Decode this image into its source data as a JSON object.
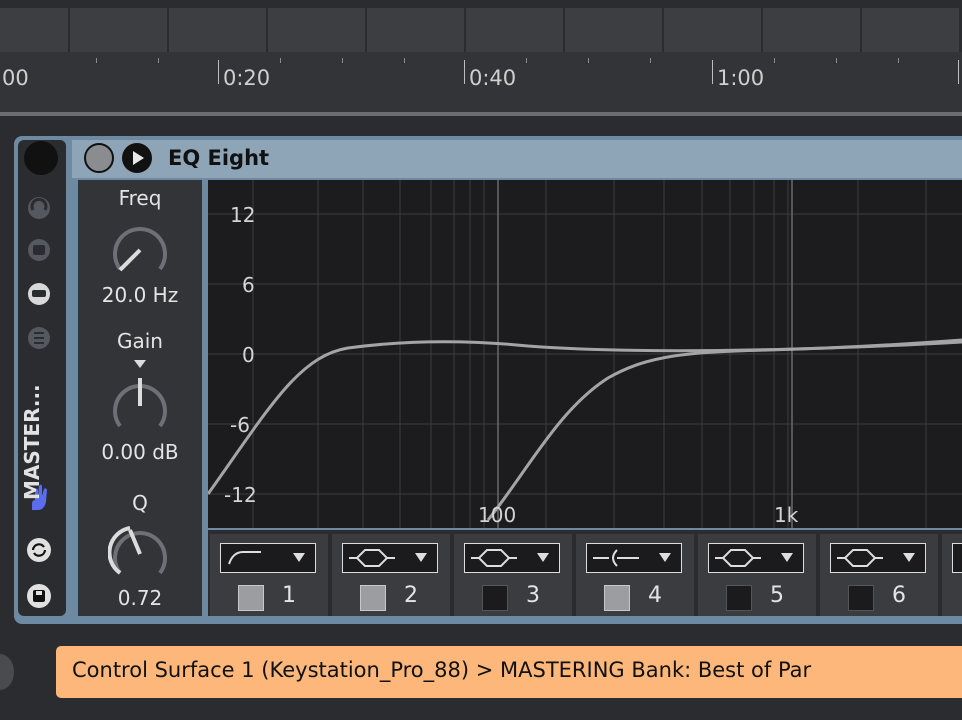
{
  "timeline": {
    "labels": [
      "00",
      "0:20",
      "0:40",
      "1:00"
    ]
  },
  "device": {
    "title": "EQ Eight",
    "sidebar_label": "MASTER...",
    "params": {
      "freq_label": "Freq",
      "freq_value": "20.0 Hz",
      "gain_label": "Gain",
      "gain_value": "0.00 dB",
      "q_label": "Q",
      "q_value": "0.72"
    },
    "graph": {
      "y_labels": [
        "12",
        "6",
        "0",
        "-6",
        "-12"
      ],
      "x_labels": [
        "100",
        "1k"
      ]
    },
    "bands": [
      {
        "number": "1",
        "filter": "high-pass",
        "active": true
      },
      {
        "number": "2",
        "filter": "bell",
        "active": true
      },
      {
        "number": "3",
        "filter": "bell",
        "active": false
      },
      {
        "number": "4",
        "filter": "notch",
        "active": true
      },
      {
        "number": "5",
        "filter": "bell",
        "active": false
      },
      {
        "number": "6",
        "filter": "bell",
        "active": false
      }
    ]
  },
  "status_bar": {
    "text": "Control Surface 1 (Keystation_Pro_88) > MASTERING Bank: Best of Par"
  },
  "colors": {
    "device_frame": "#6d8aa2",
    "title_bar": "#8ea5b7",
    "status_bar": "#fdb77a",
    "curve": "#a4a4a8",
    "hand_icon": "#5b6cf0"
  }
}
